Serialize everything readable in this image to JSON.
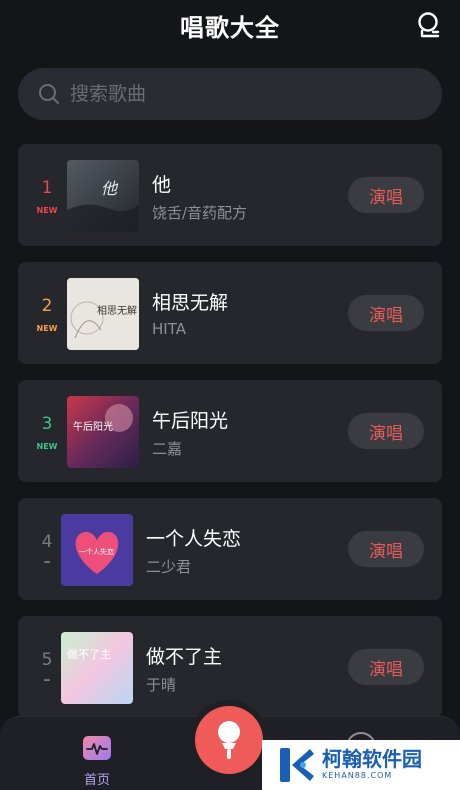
{
  "header": {
    "title": "唱歌大全"
  },
  "search": {
    "placeholder": "搜索歌曲"
  },
  "songs": [
    {
      "rank": "1",
      "tag": "NEW",
      "rank_color": "#e8474b",
      "title": "他",
      "artist": "饶舌/音药配方",
      "action": "演唱",
      "cover_text": "他"
    },
    {
      "rank": "2",
      "tag": "NEW",
      "rank_color": "#f5a04a",
      "title": "相思无解",
      "artist": "HITA",
      "action": "演唱",
      "cover_text": "相思无解"
    },
    {
      "rank": "3",
      "tag": "NEW",
      "rank_color": "#3fc28a",
      "title": "午后阳光",
      "artist": "二嘉",
      "action": "演唱",
      "cover_text": "午后阳光"
    },
    {
      "rank": "4",
      "tag": "–",
      "rank_color": "#7a7c82",
      "title": "一个人失恋",
      "artist": "二少君",
      "action": "演唱",
      "cover_text": "一个人失恋"
    },
    {
      "rank": "5",
      "tag": "–",
      "rank_color": "#7a7c82",
      "title": "做不了主",
      "artist": "于晴",
      "action": "演唱",
      "cover_text": "做不了主"
    }
  ],
  "nav": {
    "home_label": "首页"
  },
  "watermark": {
    "cn": "柯翰软件园",
    "en": "KEHAN88.COM"
  },
  "colors": {
    "accent": "#ef5b59",
    "nav_active": "#b9a3f5"
  }
}
